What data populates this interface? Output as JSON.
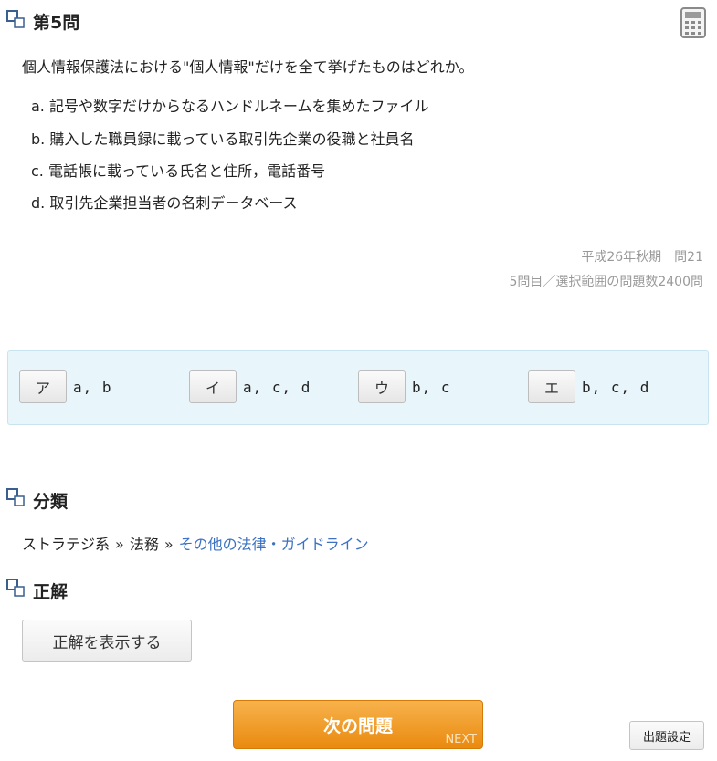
{
  "question": {
    "title": "第5問",
    "text": "個人情報保護法における\"個人情報\"だけを全て挙げたものはどれか。",
    "options": [
      "a. 記号や数字だけからなるハンドルネームを集めたファイル",
      "b. 購入した職員録に載っている取引先企業の役職と社員名",
      "c. 電話帳に載っている氏名と住所，電話番号",
      "d. 取引先企業担当者の名刺データベース"
    ],
    "source": "平成26年秋期　問21",
    "progress": "5問目／選択範囲の問題数2400問"
  },
  "answers": [
    {
      "label": "ア",
      "text": "a, b"
    },
    {
      "label": "イ",
      "text": "a, c, d"
    },
    {
      "label": "ウ",
      "text": "b, c"
    },
    {
      "label": "エ",
      "text": "b, c, d"
    }
  ],
  "category": {
    "title": "分類",
    "path": [
      "ストラテジ系",
      "法務",
      "その他の法律・ガイドライン"
    ],
    "separator": "»"
  },
  "correct": {
    "title": "正解",
    "show_label": "正解を表示する"
  },
  "nav": {
    "next_label": "次の問題",
    "next_sub": "NEXT",
    "settings_label": "出題設定"
  },
  "icons": {
    "section": "section-icon",
    "calculator": "calculator-icon"
  },
  "colors": {
    "link": "#3b72c4",
    "section_icon": "#3a5f8f",
    "next_button": "#ea8a0f",
    "answer_bg": "#e8f5fb"
  }
}
